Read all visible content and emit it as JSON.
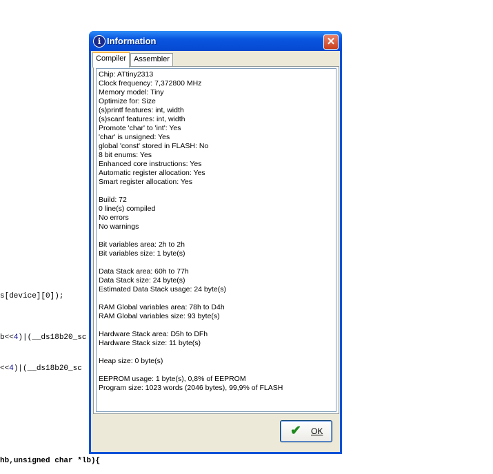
{
  "background_code": [
    {
      "text": "s[device][0]);"
    },
    {
      "pre": "b<<",
      "num": "4",
      "post": ")|(__ds18b20_sc"
    },
    {
      "pre": "<<",
      "num": "4",
      "post": ")|(__ds18b20_sc"
    },
    {
      "pre": "hb,",
      "kw": "unsigned char",
      "post": " *lb){"
    }
  ],
  "dialog": {
    "title": "Information",
    "close_icon": "close-icon",
    "tabs": [
      {
        "label": "Compiler",
        "active": true
      },
      {
        "label": "Assembler",
        "active": false
      }
    ],
    "lines": [
      "Chip: ATtiny2313",
      "Clock frequency: 7,372800 MHz",
      "Memory model: Tiny",
      "Optimize for: Size",
      "(s)printf features: int, width",
      "(s)scanf features: int, width",
      "Promote 'char' to 'int': Yes",
      "'char' is unsigned: Yes",
      "global 'const' stored in FLASH: No",
      "8 bit enums: Yes",
      "Enhanced core instructions: Yes",
      "Automatic register allocation: Yes",
      "Smart register allocation: Yes",
      "",
      "Build: 72",
      "0 line(s) compiled",
      "No errors",
      "No warnings",
      "",
      "Bit variables area: 2h to 2h",
      "Bit variables size: 1 byte(s)",
      "",
      "Data Stack area: 60h to 77h",
      "Data Stack size: 24 byte(s)",
      "Estimated Data Stack usage: 24 byte(s)",
      "",
      "RAM Global variables area: 78h to D4h",
      "RAM Global variables size: 93 byte(s)",
      "",
      "Hardware Stack area: D5h to DFh",
      "Hardware Stack size: 11 byte(s)",
      "",
      "Heap size: 0 byte(s)",
      "",
      "EEPROM usage: 1 byte(s), 0,8% of EEPROM",
      "Program size: 1023 words (2046 bytes), 99,9% of FLASH"
    ],
    "ok_label": "OK"
  }
}
